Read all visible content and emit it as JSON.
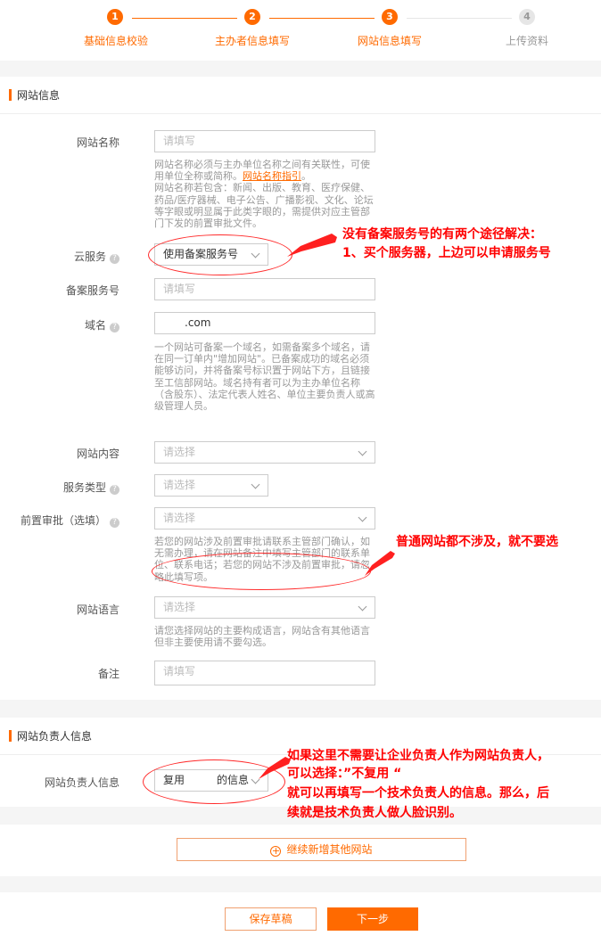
{
  "stepper": {
    "steps": [
      {
        "num": "1",
        "label": "基础信息校验"
      },
      {
        "num": "2",
        "label": "主办者信息填写"
      },
      {
        "num": "3",
        "label": "网站信息填写"
      },
      {
        "num": "4",
        "label": "上传资料"
      }
    ]
  },
  "website_section": {
    "title": "网站信息",
    "site_name": {
      "label": "网站名称",
      "placeholder": "请填写",
      "help_1": "网站名称必须与主办单位名称之间有关联性，可使用单位全称或简称。",
      "help_link": "网站名称指引",
      "help_link_suffix": "。",
      "help_2": "网站名称若包含：新闻、出版、教育、医疗保健、药品/医疗器械、电子公告、广播影视、文化、论坛等字眼或明显属于此类字眼的，需提供对应主管部门下发的前置审批文件。"
    },
    "cloud_service": {
      "label": "云服务",
      "value": "使用备案服务号"
    },
    "service_number": {
      "label": "备案服务号",
      "placeholder": "请填写"
    },
    "domain": {
      "label": "域名",
      "value": "　　.com",
      "help": "一个网站可备案一个域名，如需备案多个域名，请在同一订单内\"增加网站\"。已备案成功的域名必须能够访问，并将备案号标识置于网站下方，且链接至工信部网站。域名持有者可以为主办单位名称（含股东）、法定代表人姓名、单位主要负责人或高级管理人员。"
    },
    "site_content": {
      "label": "网站内容",
      "placeholder": "请选择"
    },
    "service_type": {
      "label": "服务类型",
      "placeholder": "请选择"
    },
    "pre_approval": {
      "label": "前置审批（选填）",
      "placeholder": "请选择",
      "help": "若您的网站涉及前置审批请联系主管部门确认，如无需办理，请在网站备注中填写主管部门的联系单位、联系电话；若您的网站不涉及前置审批，请忽略此填写项。"
    },
    "language": {
      "label": "网站语言",
      "placeholder": "请选择",
      "help": "请您选择网站的主要构成语言，网站含有其他语言但非主要使用请不要勾选。"
    },
    "remarks": {
      "label": "备注",
      "placeholder": "请填写"
    }
  },
  "owner_section": {
    "title": "网站负责人信息",
    "owner": {
      "label": "网站负责人信息",
      "value": "复用　　　的信息"
    }
  },
  "add_site_label": "继续新增其他网站",
  "footer": {
    "save_label": "保存草稿",
    "next_label": "下一步"
  },
  "annotations": {
    "a1_line1": "没有备案服务号的有两个途径解决：",
    "a1_line2": "1、买个服务器，上边可以申请服务号",
    "a2": "普通网站都不涉及，就不要选",
    "a3_line1": "如果这里不需要让企业负责人作为网站负责人，",
    "a3_line2": "可以选择：”不复用 “",
    "a3_line3": "就可以再填写一个技术负责人的信息。那么，后",
    "a3_line4": "续就是技术负责人做人脸识别。"
  },
  "colors": {
    "accent": "#ff6a00",
    "annotation": "#ff0000"
  }
}
